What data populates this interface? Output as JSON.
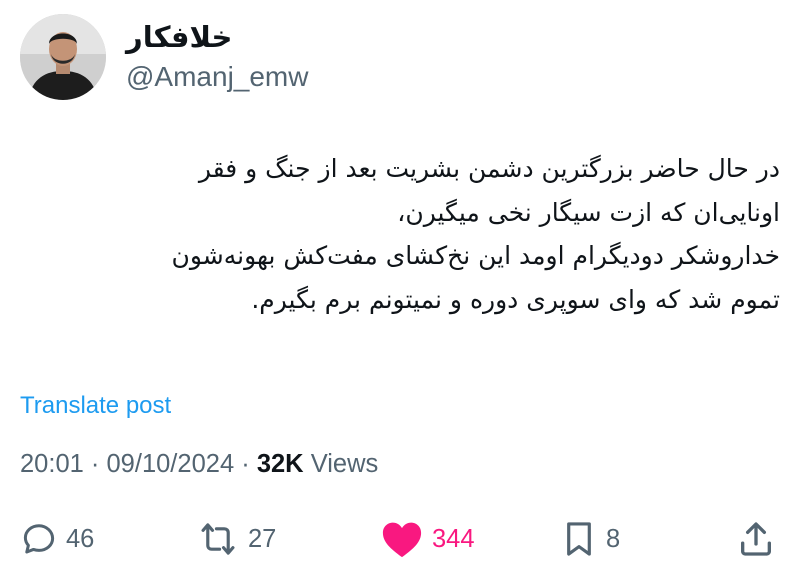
{
  "author": {
    "display_name": "خلافکار",
    "handle": "@Amanj_emw"
  },
  "tweet": {
    "lines": [
      "در حال حاضر بزرگترین دشمن بشریت بعد از جنگ و فقر",
      "اونایی‌ان که ازت سیگار نخی میگیرن،",
      "خداروشکر دودیگرام اومد این نخ‌کشای مفت‌کش بهونه‌شون",
      "تموم شد که وای سوپری دوره و نمیتونم برم بگیرم."
    ]
  },
  "translate_label": "Translate post",
  "meta": {
    "time": "20:01",
    "separator": "·",
    "date": "09/10/2024",
    "views_count": "32K",
    "views_label": "Views"
  },
  "actions": {
    "replies": "46",
    "reposts": "27",
    "likes": "344",
    "bookmarks": "8"
  },
  "colors": {
    "link": "#1d9bf0",
    "like": "#f91880",
    "secondary_text": "#536471",
    "primary_text": "#0f1419"
  },
  "icons": [
    "reply-icon",
    "repost-icon",
    "like-icon",
    "bookmark-icon",
    "share-icon"
  ]
}
